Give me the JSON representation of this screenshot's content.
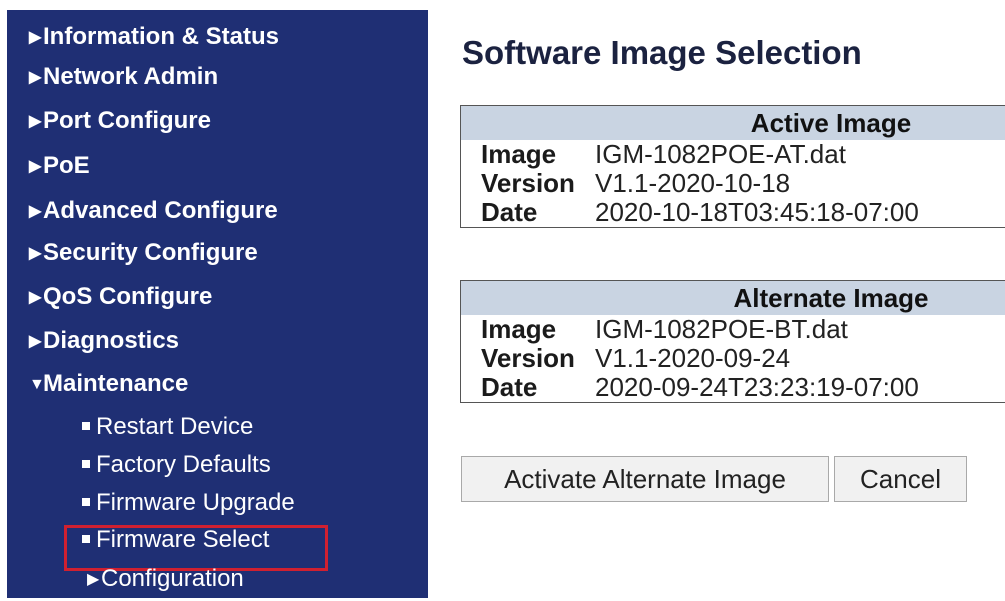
{
  "sidebar": {
    "items": [
      {
        "label": "Information & Status"
      },
      {
        "label": "Network Admin"
      },
      {
        "label": "Port Configure"
      },
      {
        "label": "PoE"
      },
      {
        "label": "Advanced Configure"
      },
      {
        "label": "Security Configure"
      },
      {
        "label": "QoS Configure"
      },
      {
        "label": "Diagnostics"
      },
      {
        "label": "Maintenance"
      }
    ],
    "maintenance_sub": [
      {
        "label": "Restart Device"
      },
      {
        "label": "Factory Defaults"
      },
      {
        "label": "Firmware Upgrade"
      },
      {
        "label": "Firmware Select"
      }
    ],
    "configuration": "Configuration"
  },
  "page": {
    "title": "Software Image Selection"
  },
  "active": {
    "header": "Active Image",
    "rows": [
      {
        "key": "Image",
        "value": "IGM-1082POE-AT.dat"
      },
      {
        "key": "Version",
        "value": "V1.1-2020-10-18"
      },
      {
        "key": "Date",
        "value": "2020-10-18T03:45:18-07:00"
      }
    ]
  },
  "alternate": {
    "header": "Alternate Image",
    "rows": [
      {
        "key": "Image",
        "value": "IGM-1082POE-BT.dat"
      },
      {
        "key": "Version",
        "value": "V1.1-2020-09-24"
      },
      {
        "key": "Date",
        "value": "2020-09-24T23:23:19-07:00"
      }
    ]
  },
  "buttons": {
    "activate": "Activate Alternate Image",
    "cancel": "Cancel"
  },
  "colors": {
    "sidebar_bg": "#1f2f74",
    "table_header_bg": "#c9d4e2",
    "highlight": "#d02030"
  }
}
